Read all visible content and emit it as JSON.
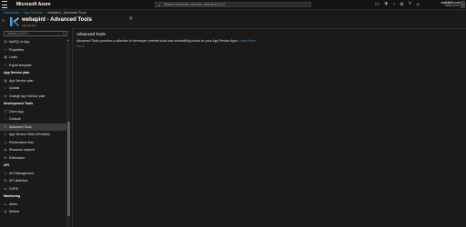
{
  "header": {
    "brand": "Microsoft Azure",
    "search_placeholder": "Search resources, services, and docs (G+/)",
    "user_email": "mail@hb.com",
    "user_directory": "DIRECTORY",
    "icons": [
      "terminal-icon",
      "filter-icon",
      "bell-icon",
      "gear-icon",
      "help-icon",
      "feedback-icon"
    ]
  },
  "breadcrumb": {
    "items": [
      "Dashboard",
      "App Services",
      "webapiml - Advanced Tools"
    ]
  },
  "app": {
    "title": "webapint - Advanced Tools",
    "subtitle": "App Service"
  },
  "sidebar": {
    "search_placeholder": "Search (Ctrl+/)",
    "items": [
      {
        "type": "item",
        "label": "MySQL In App",
        "icon": "database-icon"
      },
      {
        "type": "item",
        "label": "Properties",
        "icon": "properties-icon"
      },
      {
        "type": "item",
        "label": "Locks",
        "icon": "lock-icon"
      },
      {
        "type": "item",
        "label": "Export template",
        "icon": "export-icon"
      },
      {
        "type": "section",
        "label": "App Service plan"
      },
      {
        "type": "item",
        "label": "App Service plan",
        "icon": "plan-icon"
      },
      {
        "type": "item",
        "label": "Quotas",
        "icon": "quota-icon"
      },
      {
        "type": "item",
        "label": "Change App Service plan",
        "icon": "change-plan-icon"
      },
      {
        "type": "section",
        "label": "Development Tools"
      },
      {
        "type": "item",
        "label": "Clone App",
        "icon": "clone-icon"
      },
      {
        "type": "item",
        "label": "Console",
        "icon": "console-icon"
      },
      {
        "type": "item",
        "label": "Advanced Tools",
        "icon": "tools-icon",
        "active": true
      },
      {
        "type": "item",
        "label": "App Service Editor (Preview)",
        "icon": "editor-icon"
      },
      {
        "type": "item",
        "label": "Performance test",
        "icon": "performance-icon"
      },
      {
        "type": "item",
        "label": "Resource explorer",
        "icon": "explorer-icon"
      },
      {
        "type": "item",
        "label": "Extensions",
        "icon": "extensions-icon"
      },
      {
        "type": "section",
        "label": "API"
      },
      {
        "type": "item",
        "label": "API Management",
        "icon": "api-management-icon"
      },
      {
        "type": "item",
        "label": "API definition",
        "icon": "api-definition-icon"
      },
      {
        "type": "item",
        "label": "CORS",
        "icon": "cors-icon"
      },
      {
        "type": "section",
        "label": "Monitoring"
      },
      {
        "type": "item",
        "label": "Alerts",
        "icon": "alert-icon"
      },
      {
        "type": "item",
        "label": "Metrics",
        "icon": "metrics-icon"
      }
    ]
  },
  "main": {
    "heading": "Advanced Tools",
    "description": "Advanced Tools provides a collection of developer oriented tools and extensibility points for your App Service Apps.",
    "learn_more": "Learn More",
    "go_link": "Go ➔"
  },
  "colors": {
    "background": "#1b1a19",
    "accent": "#3b97d3",
    "active_item": "#3c3c3c"
  }
}
